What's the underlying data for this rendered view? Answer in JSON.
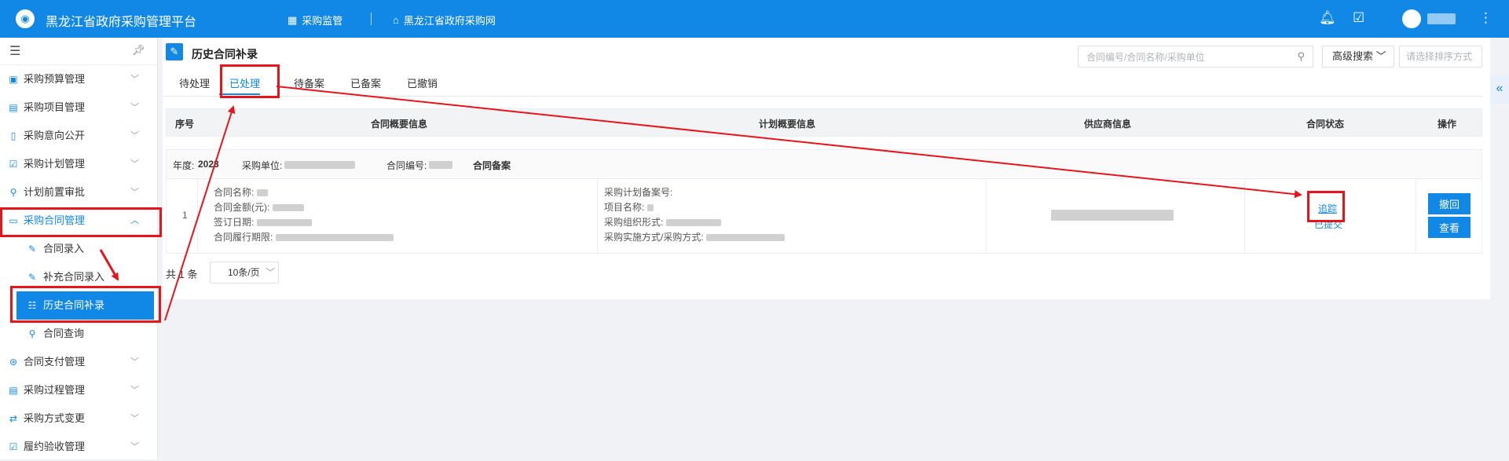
{
  "header": {
    "app_title": "黑龙江省政府采购管理平台",
    "nav_monitor": "采购监管",
    "nav_website": "黑龙江省政府采购网"
  },
  "sidebar": {
    "items": [
      {
        "label": "采购预算管理",
        "icon": "budget-icon"
      },
      {
        "label": "采购项目管理",
        "icon": "project-icon"
      },
      {
        "label": "采购意向公开",
        "icon": "intent-icon"
      },
      {
        "label": "采购计划管理",
        "icon": "plan-icon"
      },
      {
        "label": "计划前置审批",
        "icon": "approval-icon"
      },
      {
        "label": "采购合同管理",
        "icon": "contract-icon",
        "expanded": true
      },
      {
        "label": "合同录入",
        "icon": "contract-entry-icon"
      },
      {
        "label": "补充合同录入",
        "icon": "supplement-icon"
      },
      {
        "label": "历史合同补录",
        "icon": "history-icon",
        "active": true
      },
      {
        "label": "合同查询",
        "icon": "query-icon"
      },
      {
        "label": "合同支付管理",
        "icon": "payment-icon"
      },
      {
        "label": "采购过程管理",
        "icon": "process-icon"
      },
      {
        "label": "采购方式变更",
        "icon": "method-change-icon"
      },
      {
        "label": "履约验收管理",
        "icon": "acceptance-icon"
      }
    ]
  },
  "page": {
    "title": "历史合同补录",
    "search_placeholder": "合同编号/合同名称/采购单位",
    "advanced_search": "高级搜索",
    "sort_placeholder": "请选择排序方式"
  },
  "tabs": [
    "待处理",
    "已处理",
    "待备案",
    "已备案",
    "已撤销"
  ],
  "active_tab": "已处理",
  "table": {
    "headers": [
      "序号",
      "合同概要信息",
      "计划概要信息",
      "供应商信息",
      "合同状态",
      "操作"
    ],
    "group": {
      "year_label": "年度:",
      "year_value": "2023",
      "unit_label": "采购单位:",
      "contract_no_label": "合同编号:",
      "group_status": "合同备案"
    },
    "rows": [
      {
        "index": "1",
        "contract_lines": [
          "合同名称:",
          "合同金额(元):",
          "签订日期:",
          "合同履行期限:"
        ],
        "plan_lines": [
          "采购计划备案号:",
          "项目名称:",
          "采购组织形式:",
          "采购实施方式/采购方式:"
        ],
        "track_link": "追踪",
        "status": "已提交",
        "actions": [
          "撤回",
          "查看"
        ]
      }
    ]
  },
  "pagination": {
    "total": "共 1 条",
    "page_size": "10条/页"
  },
  "colors": {
    "primary": "#1188e5",
    "annotation_red": "#e6141b"
  }
}
